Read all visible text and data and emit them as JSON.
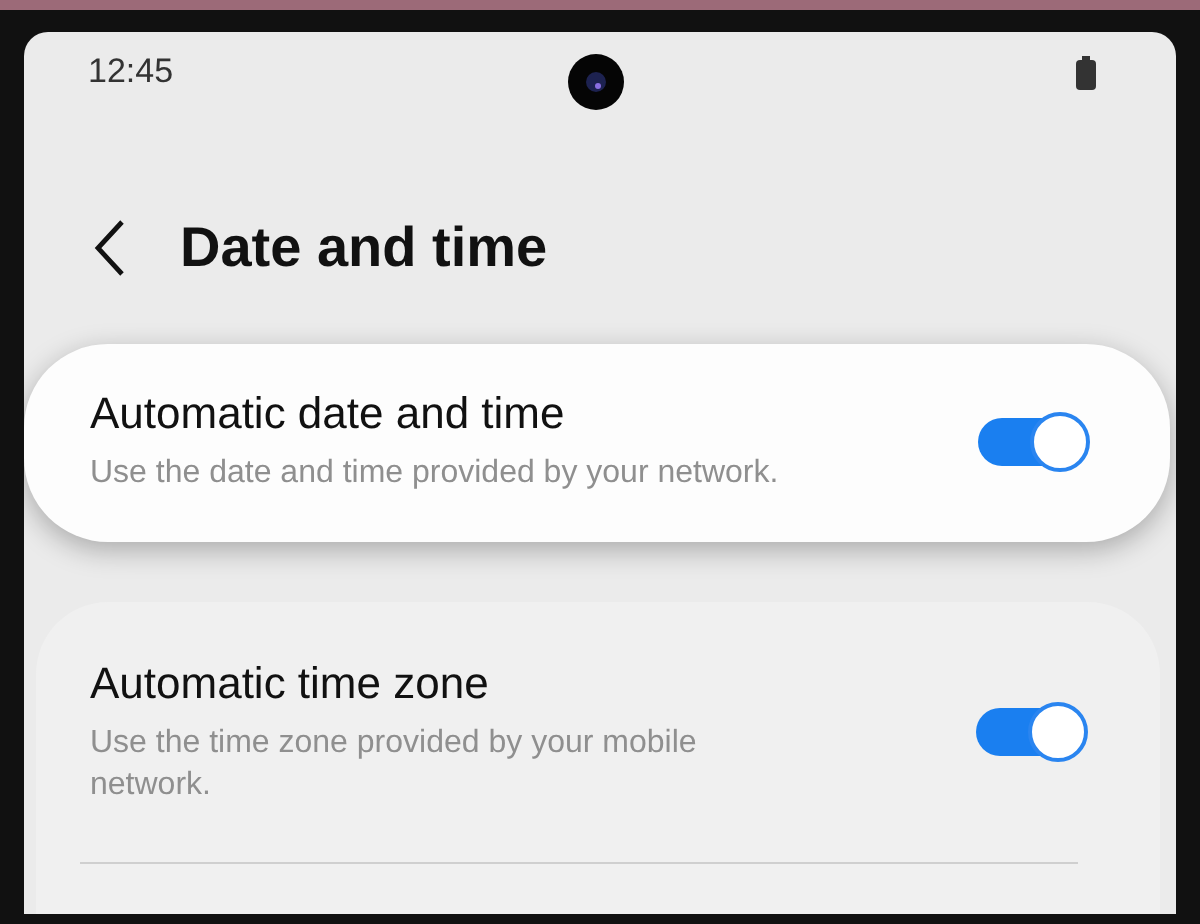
{
  "status_bar": {
    "time": "12:45"
  },
  "header": {
    "title": "Date and time"
  },
  "settings": [
    {
      "title": "Automatic date and time",
      "description": "Use the date and time provided by your network.",
      "on": true,
      "highlighted": true
    },
    {
      "title": "Automatic time zone",
      "description": "Use the time zone provided by your mobile network.",
      "on": true,
      "highlighted": false
    }
  ]
}
